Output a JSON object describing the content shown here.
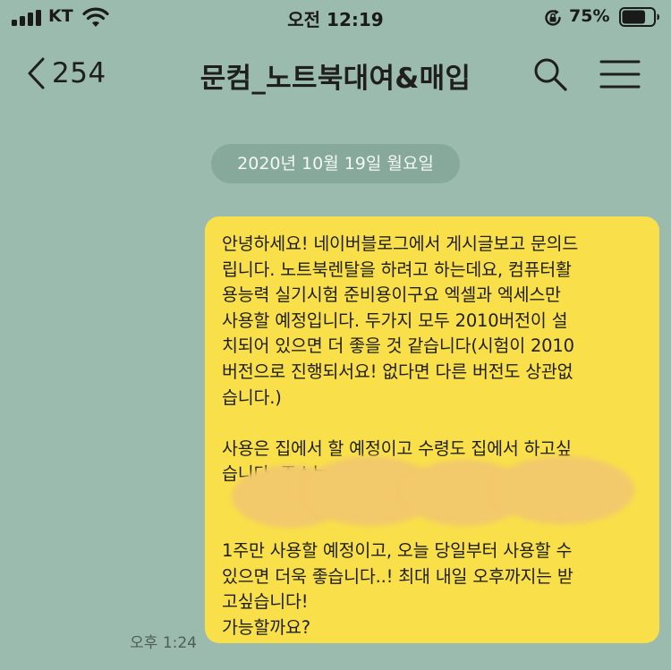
{
  "status_bar": {
    "carrier": "KT",
    "time": "오전 12:19",
    "battery_percent": "75%",
    "battery_level": 0.75,
    "icons": [
      "signal-icon",
      "wifi-icon",
      "rotation-lock-icon",
      "battery-icon"
    ]
  },
  "header": {
    "unread_count": "254",
    "title": "문컴_노트북대여&매입",
    "icons": [
      "chevron-left-icon",
      "search-icon",
      "hamburger-menu-icon"
    ]
  },
  "chat": {
    "date_divider": "2020년 10월 19일 월요일",
    "messages": [
      {
        "sender": "me",
        "time": "오후 1:24",
        "text": "안녕하세요! 네이버블로그에서 게시글보고 문의드\n립니다. 노트북렌탈을 하려고 하는데요, 컴퓨터활\n용능력 실기시험 준비용이구요 엑셀과 엑세스만\n사용할 예정입니다. 두가지 모두 2010버전이 설\n치되어 있으면 더 좋을 것 같습니다(시험이 2010\n버전으로 진행되서요! 없다면 다른 버전도 상관없\n습니다.)\n\n사용은 집에서 할 예정이고 수령도 집에서 하고싶\n습니다. 주소는 서울\n\n\n1주만 사용할 예정이고, 오늘 당일부터 사용할 수\n있으면 더욱 좋습니다..! 최대 내일 오후까지는 받\n고싶습니다!\n가능할까요?"
      }
    ]
  },
  "colors": {
    "background": "#9bbbae",
    "date_pill": "#86a99b",
    "bubble": "#f9e04a",
    "text": "#1f1f1f"
  }
}
